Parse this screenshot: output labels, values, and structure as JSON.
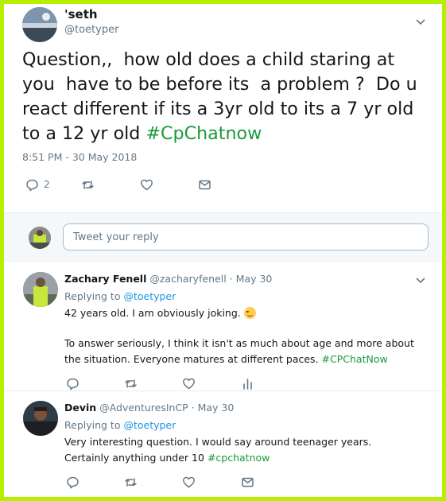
{
  "main_tweet": {
    "author_name": "'seth",
    "author_handle": "@toetyper",
    "text_plain": "Question,,  how old does a child staring at you  have to be before its  a problem ?  Do u react different if its a 3yr old to its a 7 yr old to a 12 yr old ",
    "hashtag": "#CpChatnow",
    "timestamp": "8:51 PM - 30 May 2018",
    "reply_count": "2",
    "icons": {
      "reply": "reply-icon",
      "retweet": "retweet-icon",
      "like": "heart-icon",
      "dm": "envelope-icon",
      "more": "chevron-down-icon"
    }
  },
  "reply_box": {
    "placeholder": "Tweet your reply"
  },
  "replies": [
    {
      "author_name": "Zachary Fenell",
      "author_handle": "@zacharyfenell",
      "date": "· May 30",
      "replying_label": "Replying to ",
      "replying_to": "@toetyper",
      "body_line1": "42 years old. I am obviously joking. ",
      "body_line2": "To answer seriously, I think it isn't as much about age and more about the situation. Everyone matures at different paces. ",
      "hashtag": "#CPChatNow",
      "icons": [
        "reply-icon",
        "retweet-icon",
        "heart-icon",
        "analytics-icon"
      ]
    },
    {
      "author_name": "Devin",
      "author_handle": "@AdventuresInCP",
      "date": "· May 30",
      "replying_label": "Replying to ",
      "replying_to": "@toetyper",
      "body": "Very interesting question. I would say around teenager years. Certainly anything under 10 ",
      "hashtag": "#cpchatnow",
      "icons": [
        "reply-icon",
        "retweet-icon",
        "heart-icon",
        "envelope-icon"
      ]
    }
  ],
  "colors": {
    "frame_border": "#b6f000",
    "text": "#14171a",
    "muted": "#657786",
    "link": "#1b95e0",
    "hashtag_green": "#1a9a3a"
  }
}
